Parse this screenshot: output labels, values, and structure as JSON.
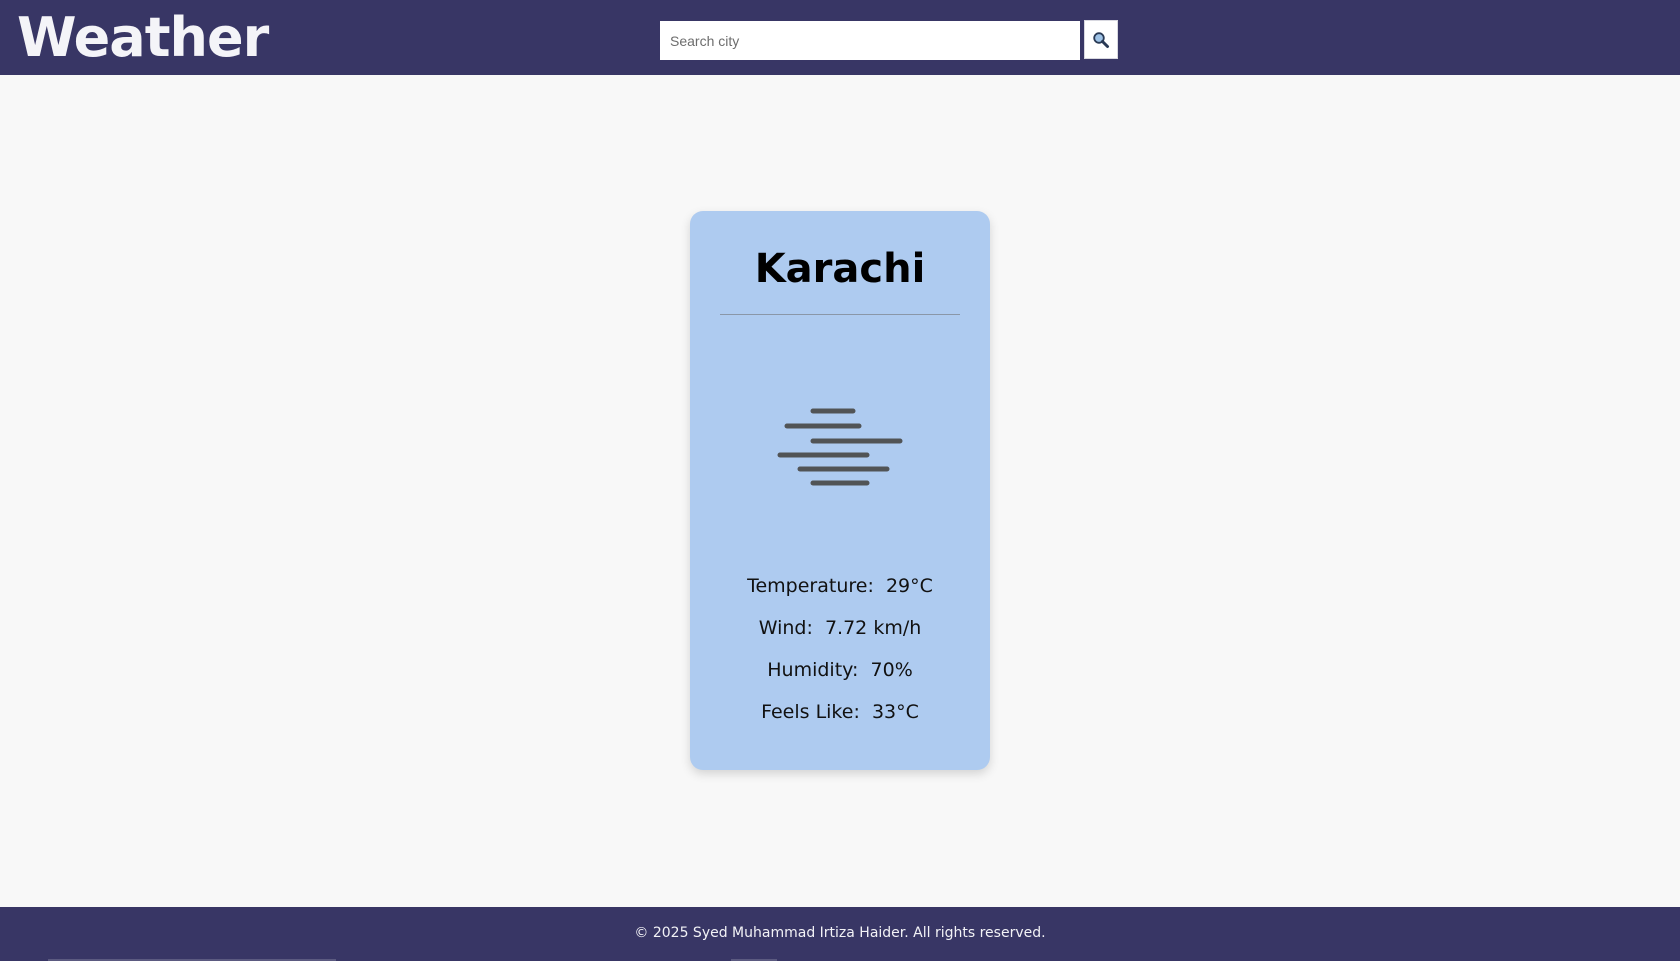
{
  "header": {
    "logo_text": "Weather",
    "search_placeholder": "Search city",
    "search_value": "",
    "search_button_icon": "magnifier-icon"
  },
  "card": {
    "city": "Karachi",
    "condition_icon": "haze-icon",
    "temperature_label": "Temperature:",
    "temperature_value": "29°C",
    "wind_label": "Wind:",
    "wind_value": "7.72 km/h",
    "humidity_label": "Humidity:",
    "humidity_value": "70%",
    "feels_like_label": "Feels Like:",
    "feels_like_value": "33°C"
  },
  "footer": {
    "copyright": "© 2025 Syed Muhammad Irtiza Haider. All rights reserved."
  },
  "colors": {
    "header_bg": "#383665",
    "page_bg": "#f8f8f8",
    "card_bg": "#aecbf0",
    "icon_lines": "#4a4a4a"
  }
}
